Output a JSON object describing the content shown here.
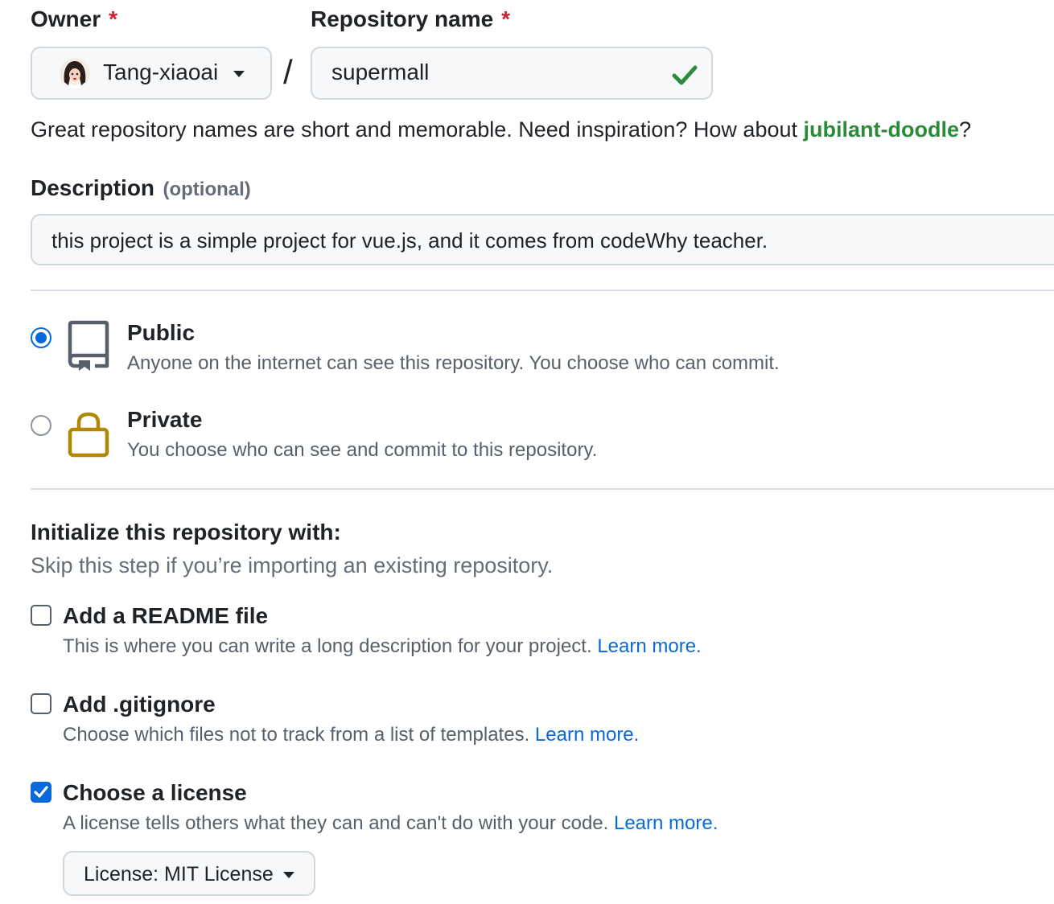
{
  "owner": {
    "label": "Owner",
    "required_mark": "*",
    "value": "Tang-xiaoai"
  },
  "repo": {
    "label": "Repository name",
    "required_mark": "*",
    "value": "supermall",
    "separator": "/"
  },
  "hint": {
    "text": "Great repository names are short and memorable. Need inspiration? How about ",
    "suggestion": "jubilant-doodle",
    "suffix": "?"
  },
  "description": {
    "label": "Description",
    "optional": "(optional)",
    "value": "this project is a simple project for vue.js, and it comes from codeWhy teacher."
  },
  "visibility": {
    "selected": "public",
    "options": [
      {
        "id": "public",
        "title": "Public",
        "desc": "Anyone on the internet can see this repository. You choose who can commit.",
        "icon": "repo-icon"
      },
      {
        "id": "private",
        "title": "Private",
        "desc": "You choose who can see and commit to this repository.",
        "icon": "lock-icon"
      }
    ]
  },
  "init": {
    "heading": "Initialize this repository with:",
    "subheading": "Skip this step if you’re importing an existing repository.",
    "options": [
      {
        "title": "Add a README file",
        "desc": "This is where you can write a long description for your project.",
        "link": "Learn more.",
        "checked": false
      },
      {
        "title": "Add .gitignore",
        "desc": "Choose which files not to track from a list of templates.",
        "link": "Learn more.",
        "checked": false
      },
      {
        "title": "Choose a license",
        "desc": "A license tells others what they can and can't do with your code.",
        "link": "Learn more.",
        "checked": true
      }
    ],
    "license_button": "License: MIT License"
  },
  "colors": {
    "accent_blue": "#0969da",
    "success_green": "#2c8a3a",
    "required_red": "#cf222e",
    "lock_gold": "#b08800"
  }
}
